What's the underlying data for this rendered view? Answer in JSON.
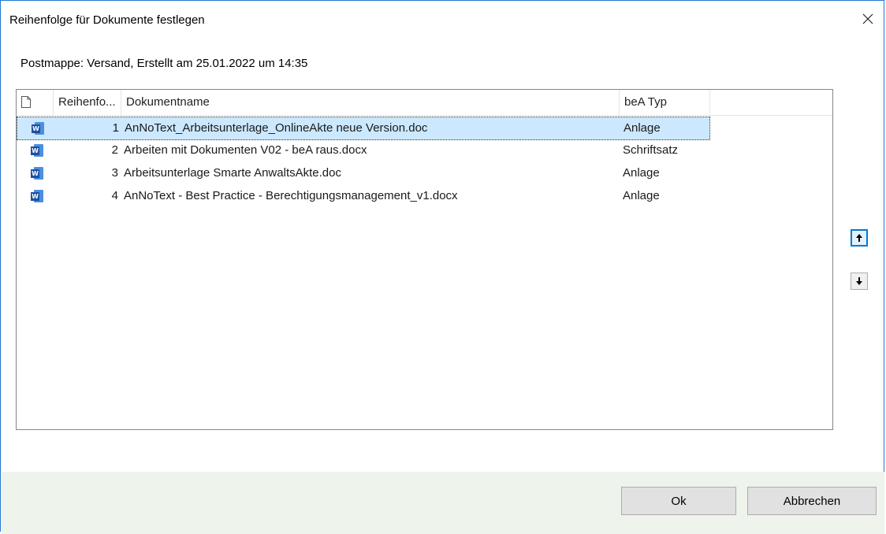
{
  "dialog": {
    "title": "Reihenfolge für Dokumente festlegen",
    "subtitle": "Postmappe: Versand, Erstellt am 25.01.2022 um 14:35"
  },
  "columns": {
    "order": "Reihenfo...",
    "name": "Dokumentname",
    "type": "beA Typ"
  },
  "documents": [
    {
      "order": "1",
      "name": "AnNoText_Arbeitsunterlage_OnlineAkte neue Version.doc",
      "type": "Anlage",
      "icon": "word-document-icon",
      "selected": true
    },
    {
      "order": "2",
      "name": "Arbeiten mit Dokumenten V02 - beA raus.docx",
      "type": "Schriftsatz",
      "icon": "word-document-icon",
      "selected": false
    },
    {
      "order": "3",
      "name": "Arbeitsunterlage Smarte AnwaltsAkte.doc",
      "type": "Anlage",
      "icon": "word-document-icon",
      "selected": false
    },
    {
      "order": "4",
      "name": "AnNoText - Best Practice - Berechtigungsmanagement_v1.docx",
      "type": "Anlage",
      "icon": "word-document-icon",
      "selected": false
    }
  ],
  "buttons": {
    "ok": "Ok",
    "cancel": "Abbrechen",
    "move_up_icon": "arrow-up-icon",
    "move_down_icon": "arrow-down-icon"
  },
  "colors": {
    "accent": "#0078d7",
    "selection": "#cce8ff",
    "footer": "#eef3ec"
  }
}
